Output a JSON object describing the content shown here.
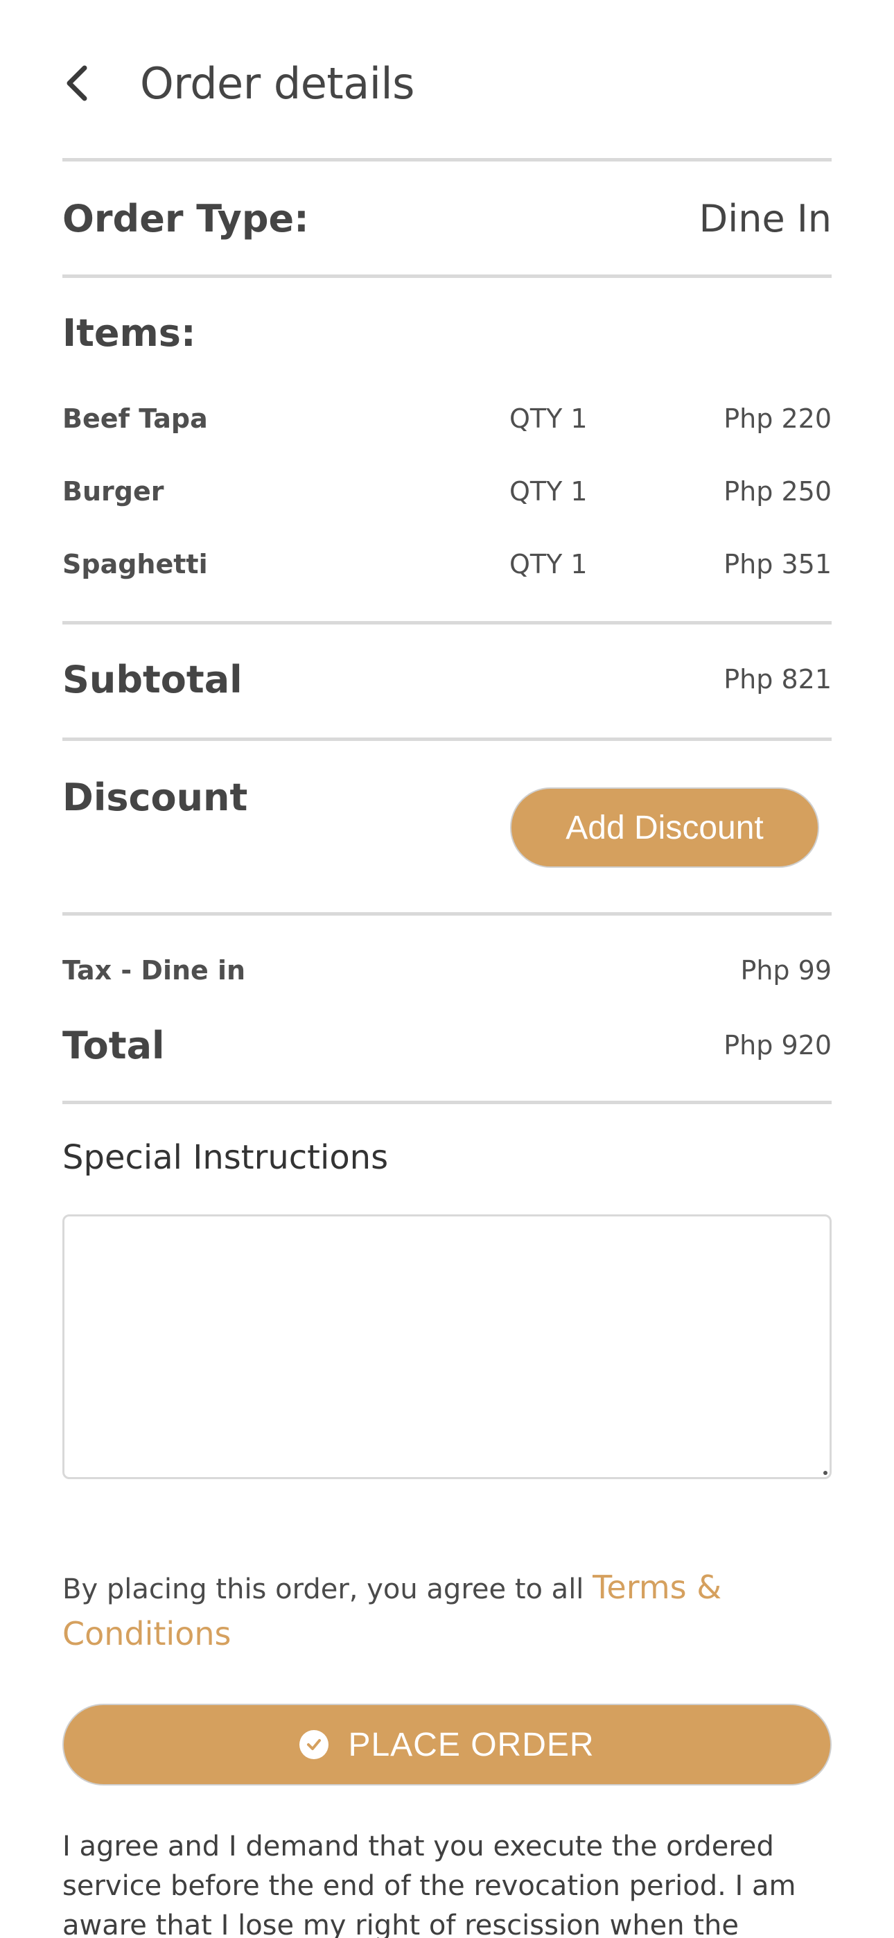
{
  "header": {
    "title": "Order details"
  },
  "order_type": {
    "label": "Order Type:",
    "value": "Dine In"
  },
  "items": {
    "heading": "Items:",
    "list": [
      {
        "name": "Beef Tapa",
        "qty": "QTY 1",
        "price": "Php 220"
      },
      {
        "name": "Burger",
        "qty": "QTY 1",
        "price": "Php 250"
      },
      {
        "name": "Spaghetti",
        "qty": "QTY 1",
        "price": "Php 351"
      }
    ]
  },
  "subtotal": {
    "label": "Subtotal",
    "amount": "Php 821"
  },
  "discount": {
    "label": "Discount",
    "button_label": "Add Discount"
  },
  "tax": {
    "label": "Tax - Dine in",
    "amount": "Php 99"
  },
  "total": {
    "label": "Total",
    "amount": "Php 920"
  },
  "special_instructions": {
    "label": "Special Instructions",
    "value": ""
  },
  "terms": {
    "text": "By placing this order, you agree to all ",
    "link_label": "Terms & Conditions"
  },
  "place_order": {
    "label": "PLACE ORDER"
  },
  "disclaimer": {
    "text": "I agree and I demand that you execute the ordered service before the end of the revocation period. I am aware that I lose my right of rescission when the service"
  },
  "colors": {
    "accent": "#d5a05e",
    "divider": "#d9d9d9",
    "text": "#4a4a4a"
  }
}
